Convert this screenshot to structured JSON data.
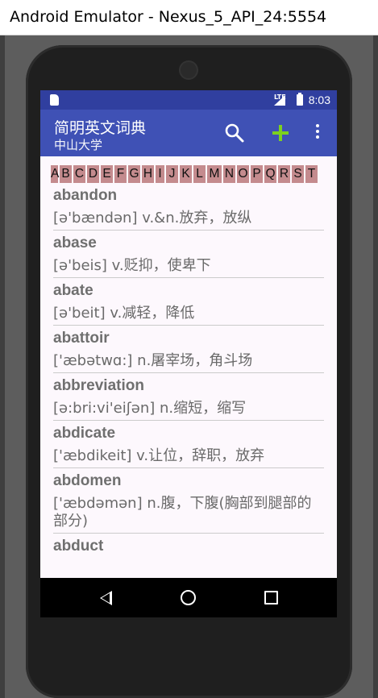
{
  "window": {
    "title": "Android Emulator - Nexus_5_API_24:5554"
  },
  "statusbar": {
    "network": "LTE",
    "time": "8:03"
  },
  "appbar": {
    "title": "简明英文词典",
    "subtitle": "中山大学",
    "icons": [
      "search-icon",
      "add-icon",
      "overflow-menu-icon"
    ],
    "accent_color": "#7cd11f",
    "background_color": "#3f51b5"
  },
  "alphabet": [
    "A",
    "B",
    "C",
    "D",
    "E",
    "F",
    "G",
    "H",
    "I",
    "J",
    "K",
    "L",
    "M",
    "N",
    "O",
    "P",
    "Q",
    "R",
    "S",
    "T"
  ],
  "words": [
    {
      "word": "abandon",
      "definition": "[ə'bændən] v.&n.放弃，放纵"
    },
    {
      "word": "abase",
      "definition": "[ə'beis] v.贬抑，使卑下"
    },
    {
      "word": "abate",
      "definition": "[ə'beit] v.减轻，降低"
    },
    {
      "word": "abattoir",
      "definition": "['æbətwɑ:] n.屠宰场，角斗场"
    },
    {
      "word": "abbreviation",
      "definition": "[ə:bri:vi'eiʃən] n.缩短，缩写"
    },
    {
      "word": "abdicate",
      "definition": "['æbdikeit] v.让位，辞职，放弃"
    },
    {
      "word": "abdomen",
      "definition": "['æbdəmən] n.腹，下腹(胸部到腿部的部分)"
    },
    {
      "word": "abduct",
      "definition": ""
    }
  ]
}
